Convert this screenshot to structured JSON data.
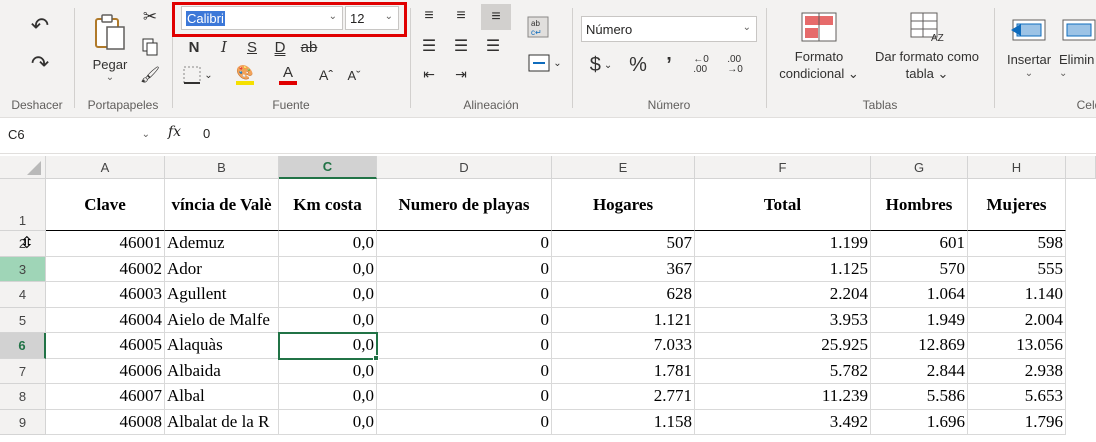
{
  "ribbon": {
    "undo_group": {
      "label": "Deshacer"
    },
    "clipboard": {
      "label": "Portapapeles",
      "paste_label": "Pegar"
    },
    "font": {
      "label": "Fuente",
      "font_name": "Calibri",
      "font_size": "12",
      "bold": "N",
      "italic": "I",
      "underline": "S",
      "double_underline": "D",
      "strike": "ab",
      "grow": "Aˆ",
      "shrink": "Aˇ"
    },
    "alignment": {
      "label": "Alineación"
    },
    "number": {
      "label": "Número",
      "format": "Número",
      "currency": "$",
      "percent": "%",
      "comma": ")"
    },
    "tables": {
      "label": "Tablas",
      "cond_format_line1": "Formato",
      "cond_format_line2": "condicional",
      "format_table_line1": "Dar formato como",
      "format_table_line2": "tabla"
    },
    "cells": {
      "label": "Celda",
      "insert": "Insertar",
      "delete": "Elimin"
    }
  },
  "formula_bar": {
    "name_box": "C6",
    "fx": "fx",
    "value": "0"
  },
  "columns": [
    "A",
    "B",
    "C",
    "D",
    "E",
    "F",
    "G",
    "H"
  ],
  "header_row": [
    "Clave",
    "víncia de Valè",
    "Km costa",
    "Numero de playas",
    "Hogares",
    "Total",
    "Hombres",
    "Mujeres"
  ],
  "rows": [
    {
      "num": "2",
      "cells": [
        "46001",
        "Ademuz",
        "0,0",
        "0",
        "507",
        "1.199",
        "601",
        "598"
      ]
    },
    {
      "num": "3",
      "cells": [
        "46002",
        "Ador",
        "0,0",
        "0",
        "367",
        "1.125",
        "570",
        "555"
      ]
    },
    {
      "num": "4",
      "cells": [
        "46003",
        "Agullent",
        "0,0",
        "0",
        "628",
        "2.204",
        "1.064",
        "1.140"
      ]
    },
    {
      "num": "5",
      "cells": [
        "46004",
        "Aielo de Malfe",
        "0,0",
        "0",
        "1.121",
        "3.953",
        "1.949",
        "2.004"
      ]
    },
    {
      "num": "6",
      "cells": [
        "46005",
        "Alaquàs",
        "0,0",
        "0",
        "7.033",
        "25.925",
        "12.869",
        "13.056"
      ]
    },
    {
      "num": "7",
      "cells": [
        "46006",
        "Albaida",
        "0,0",
        "0",
        "1.781",
        "5.782",
        "2.844",
        "2.938"
      ]
    },
    {
      "num": "8",
      "cells": [
        "46007",
        "Albal",
        "0,0",
        "0",
        "2.771",
        "11.239",
        "5.586",
        "5.653"
      ]
    },
    {
      "num": "9",
      "cells": [
        "46008",
        "Albalat de la R",
        "0,0",
        "0",
        "1.158",
        "3.492",
        "1.696",
        "1.796"
      ]
    }
  ],
  "row1_num": "1",
  "active_cell": "C6"
}
